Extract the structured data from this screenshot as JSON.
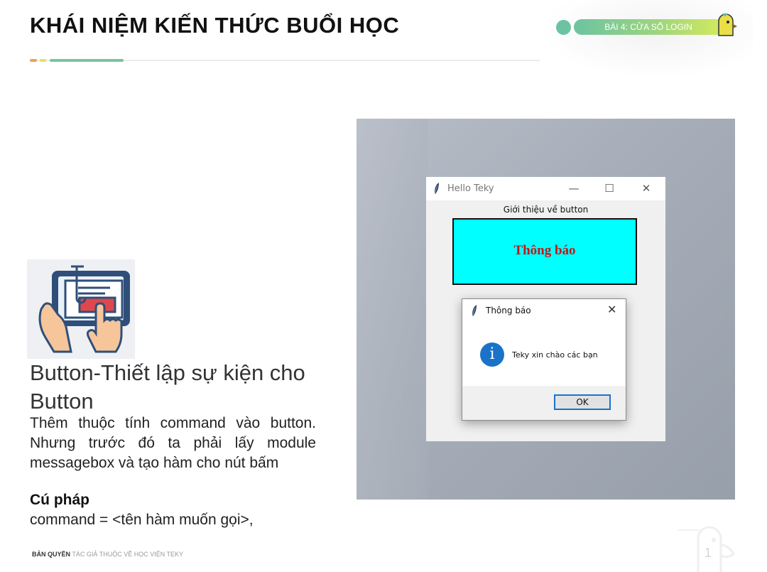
{
  "header": {
    "title": "KHÁI NIỆM KIẾN THỨC BUỔI HỌC",
    "lesson_badge": "BÀI 4: CỬA SỔ LOGIN"
  },
  "content": {
    "heading": "Button-Thiết lập sự kiện cho Button",
    "body": "Thêm thuộc tính command vào button. Nhưng trước đó ta phải lấy module messagebox và tạo hàm cho nút bấm",
    "syntax_label": "Cú pháp",
    "syntax_code": "command = <tên hàm muốn gọi>,"
  },
  "screenshot": {
    "window": {
      "title": "Hello Teky",
      "label": "Giới thiệu về button",
      "button_text": "Thông báo",
      "minimize": "—",
      "maximize": "☐",
      "close": "✕"
    },
    "dialog": {
      "title": "Thông báo",
      "message": "Teky xin chào các bạn",
      "ok_label": "OK",
      "close": "✕",
      "info_glyph": "i"
    }
  },
  "footer": {
    "copyright_bold": "BẢN QUYỀN",
    "copyright_rest": "TÁC GIẢ THUỘC VỀ HỌC VIỆN TEKY",
    "page_number": "1"
  },
  "colors": {
    "accent_green": "#6cc3a2",
    "button_cyan": "#00ffff",
    "button_text_red": "#c01818",
    "info_blue": "#1a73c8"
  },
  "icons": [
    "tablet-touch-illustration",
    "tk-feather-icon",
    "info-icon",
    "mascot-icon"
  ]
}
